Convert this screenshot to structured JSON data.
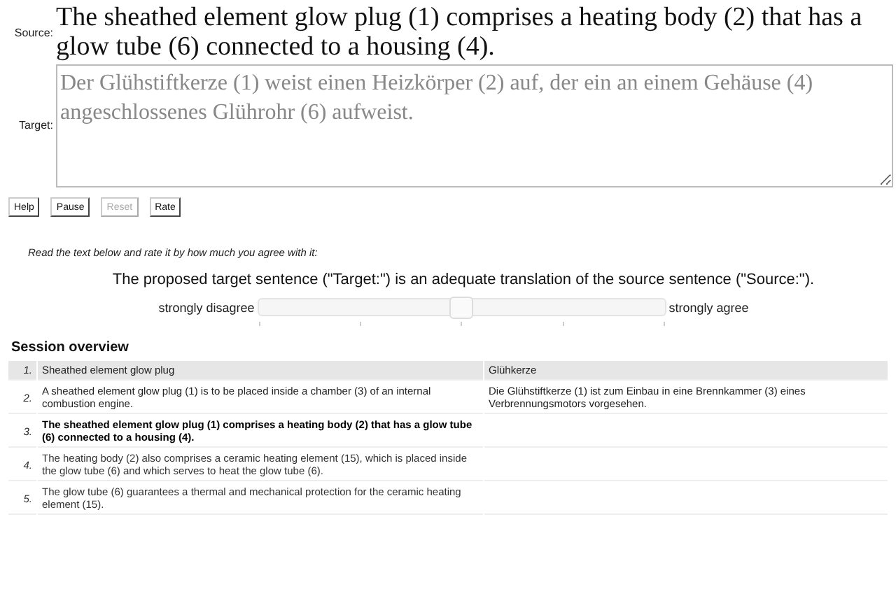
{
  "source": {
    "label": "Source:",
    "text": "The sheathed element glow plug (1) comprises a heating body (2) that has a glow tube (6) connected to a housing (4)."
  },
  "target": {
    "label": "Target:",
    "value": "Der Glühstiftkerze (1) weist einen Heizkörper (2) auf, der ein an einem Gehäuse (4) angeschlossenes Glührohr (6) aufweist."
  },
  "buttons": [
    {
      "label": "Help",
      "disabled": false
    },
    {
      "label": "Pause",
      "disabled": false
    },
    {
      "label": "Reset",
      "disabled": true
    },
    {
      "label": "Rate",
      "disabled": false
    }
  ],
  "rating": {
    "instruction": "Read the text below and rate it by how much you agree with it:",
    "statement": "The proposed target sentence (\"Target:\") is an adequate translation of the source sentence (\"Source:\").",
    "min_label": "strongly disagree",
    "max_label": "strongly agree",
    "level": 0.5
  },
  "session_overview": {
    "title": "Session overview",
    "rows": [
      {
        "number": "1.",
        "source": "Sheathed element glow plug",
        "target": "Glühkerze",
        "kind": "heading"
      },
      {
        "number": "2.",
        "source": "A sheathed element glow plug (1) is to be placed inside a chamber (3) of an internal combustion engine.",
        "target": "Die Glühstiftkerze (1) ist zum Einbau in eine Brennkammer (3) eines Verbrennungsmotors vorgesehen.",
        "kind": "done"
      },
      {
        "number": "3.",
        "source": "The sheathed element glow plug (1) comprises a heating body (2) that has a glow tube (6) connected to a housing (4).",
        "kind": "current"
      },
      {
        "number": "4.",
        "source": "The heating body (2) also comprises a ceramic heating element (15), which is placed inside the glow tube (6) and which serves to heat the glow tube (6).",
        "kind": "pending"
      },
      {
        "number": "5.",
        "source": "The glow tube (6) guarantees a thermal and mechanical protection for the ceramic heating element (15).",
        "kind": "pending"
      }
    ]
  }
}
